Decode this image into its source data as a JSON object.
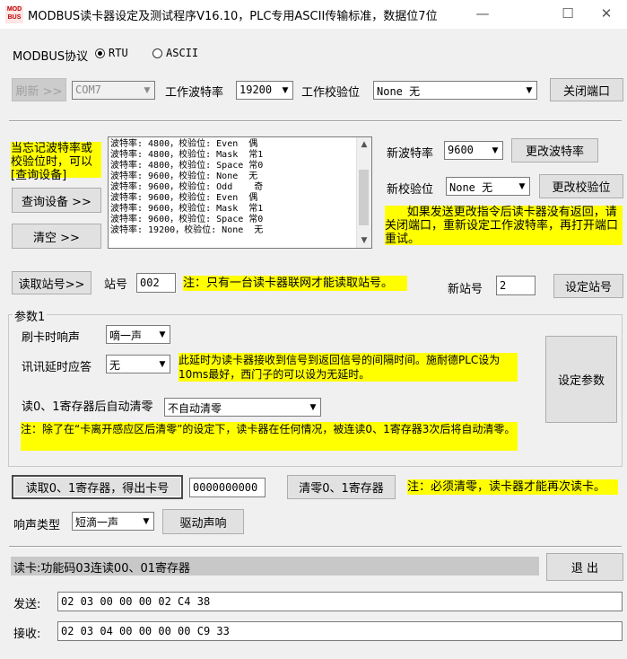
{
  "window": {
    "title": "MODBUS读卡器设定及测试程序V16.10，PLC专用ASCII传输标准，数据位7位",
    "icon_text": "MOD BUS",
    "controls": [
      "minimize-icon",
      "maximize-icon",
      "close-icon"
    ]
  },
  "protocol": {
    "label": "MODBUS协议",
    "rtu": "RTU",
    "ascii": "ASCII",
    "selected": "RTU"
  },
  "connection": {
    "refresh_button": "刷新 >>",
    "port": "COM7",
    "baud_label": "工作波特率",
    "baud_value": "19200",
    "parity_label": "工作校验位",
    "parity_value": "None   无",
    "close_port_button": "关闭端口"
  },
  "scan": {
    "hint": "当忘记波特率或校验位时，可以[查询设备]",
    "query_button": "查询设备 >>",
    "clear_button": "清空 >>",
    "results": [
      "波特率: 4800，校验位: Even  偶",
      "波特率: 4800，校验位: Mask  常1",
      "波特率: 4800，校验位: Space 常0",
      "波特率: 9600，校验位: None  无",
      "波特率: 9600，校验位: Odd    奇",
      "波特率: 9600，校验位: Even  偶",
      "波特率: 9600，校验位: Mask  常1",
      "波特率: 9600，校验位: Space 常0",
      "波特率: 19200，校验位: None  无"
    ],
    "new_baud_label": "新波特率",
    "new_baud_value": "9600",
    "change_baud_button": "更改波特率",
    "new_parity_label": "新校验位",
    "new_parity_value": "None   无",
    "change_parity_button": "更改校验位",
    "change_note": "      如果发送更改指令后读卡器没有返回，请关闭端口，重新设定工作波特率，再打开端口重试。"
  },
  "station": {
    "read_button": "读取站号>>",
    "label": "站号",
    "value": "002",
    "note": "注：只有一台读卡器联网才能读取站号。",
    "new_label": "新站号",
    "new_value": "2",
    "set_button": "设定站号"
  },
  "params": {
    "group_label": "参数1",
    "beep_label": "刷卡时响声",
    "beep_value": "嘀一声",
    "delay_label": "讯讯延时应答",
    "delay_value": "无",
    "delay_note": "此延时为读卡器接收到信号到返回信号的间隔时间。施耐德PLC设为10ms最好，西门子的可以设为无延时。",
    "autoclear_label": "读0、1寄存器后自动清零",
    "autoclear_value": "不自动清零",
    "autoclear_note": "注：除了在“卡离开感应区后清零”的设定下，读卡器在任何情况，被连读0、1寄存器3次后将自动清零。",
    "set_button": "设定参数"
  },
  "register": {
    "read_button": "读取0、1寄存器，得出卡号",
    "card_value": "0000000000",
    "clear_button": "清零0、1寄存器",
    "note": "注：必须清零，读卡器才能再次读卡。"
  },
  "sound": {
    "label": "响声类型",
    "value": "短滴一声",
    "drive_button": "驱动声响"
  },
  "status": {
    "text": "读卡:功能码03连读00、01寄存器",
    "exit_button": "退 出"
  },
  "comm": {
    "send_label": "发送:",
    "send_value": "02 03 00 00 00 02 C4 38",
    "recv_label": "接收:",
    "recv_value": "02 03 04 00 00 00 00 C9 33"
  },
  "colors": {
    "highlight": "#ffff00",
    "button": "#e1e1e1",
    "window_bg": "#f0f0f0"
  }
}
